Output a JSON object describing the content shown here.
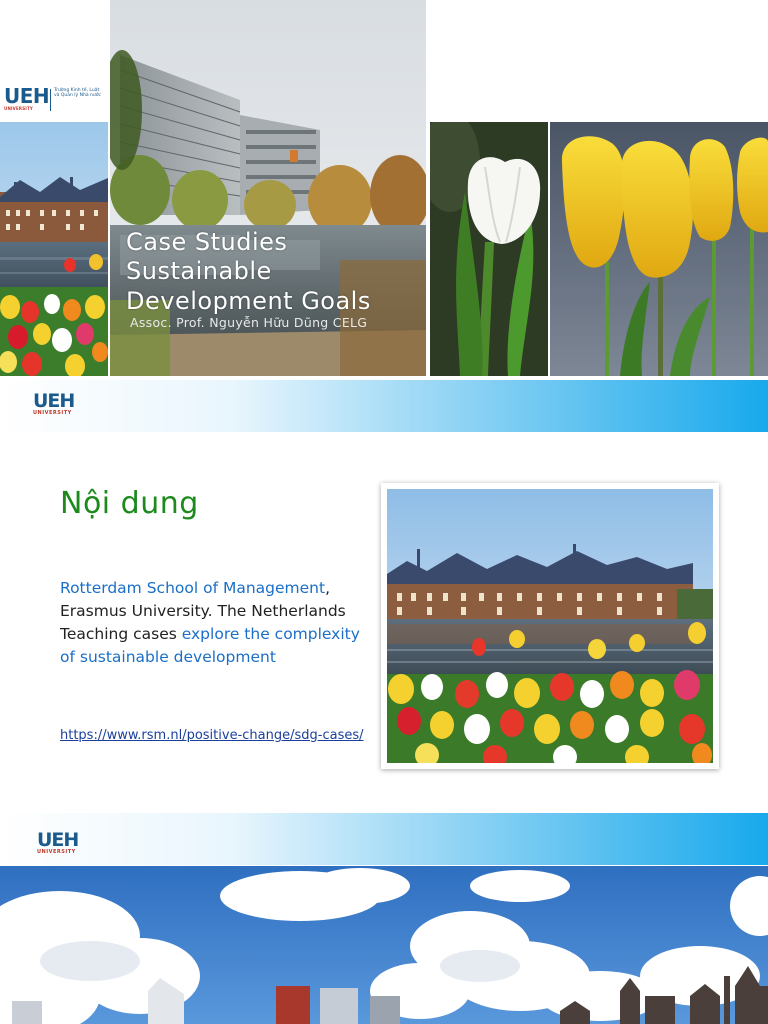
{
  "logo": {
    "mark": "UEH",
    "sub": "UNIVERSITY",
    "text_line1": "Trường Kinh tế, Luật",
    "text_line2": "và Quản lý Nhà nước"
  },
  "slide1": {
    "title_line1": "Case Studies",
    "title_line2": "Sustainable",
    "title_line3": "Development Goals",
    "subtitle": "Assoc. Prof. Nguyễn Hữu Dũng CELG"
  },
  "slide2": {
    "heading": "Nội dung",
    "body_part1": "Rotterdam School of Management",
    "body_part2": ",",
    "body_part3": "Erasmus University. The Netherlands",
    "body_part4": "Teaching cases ",
    "body_part5": "explore the complexity of sustainable development",
    "link": "https://www.rsm.nl/positive-change/sdg-cases/"
  },
  "colors": {
    "brand_blue": "#1b5a8c",
    "heading_green": "#1e8a1e",
    "link_blue": "#1b6fc8",
    "band_cyan": "#18a9ec"
  }
}
